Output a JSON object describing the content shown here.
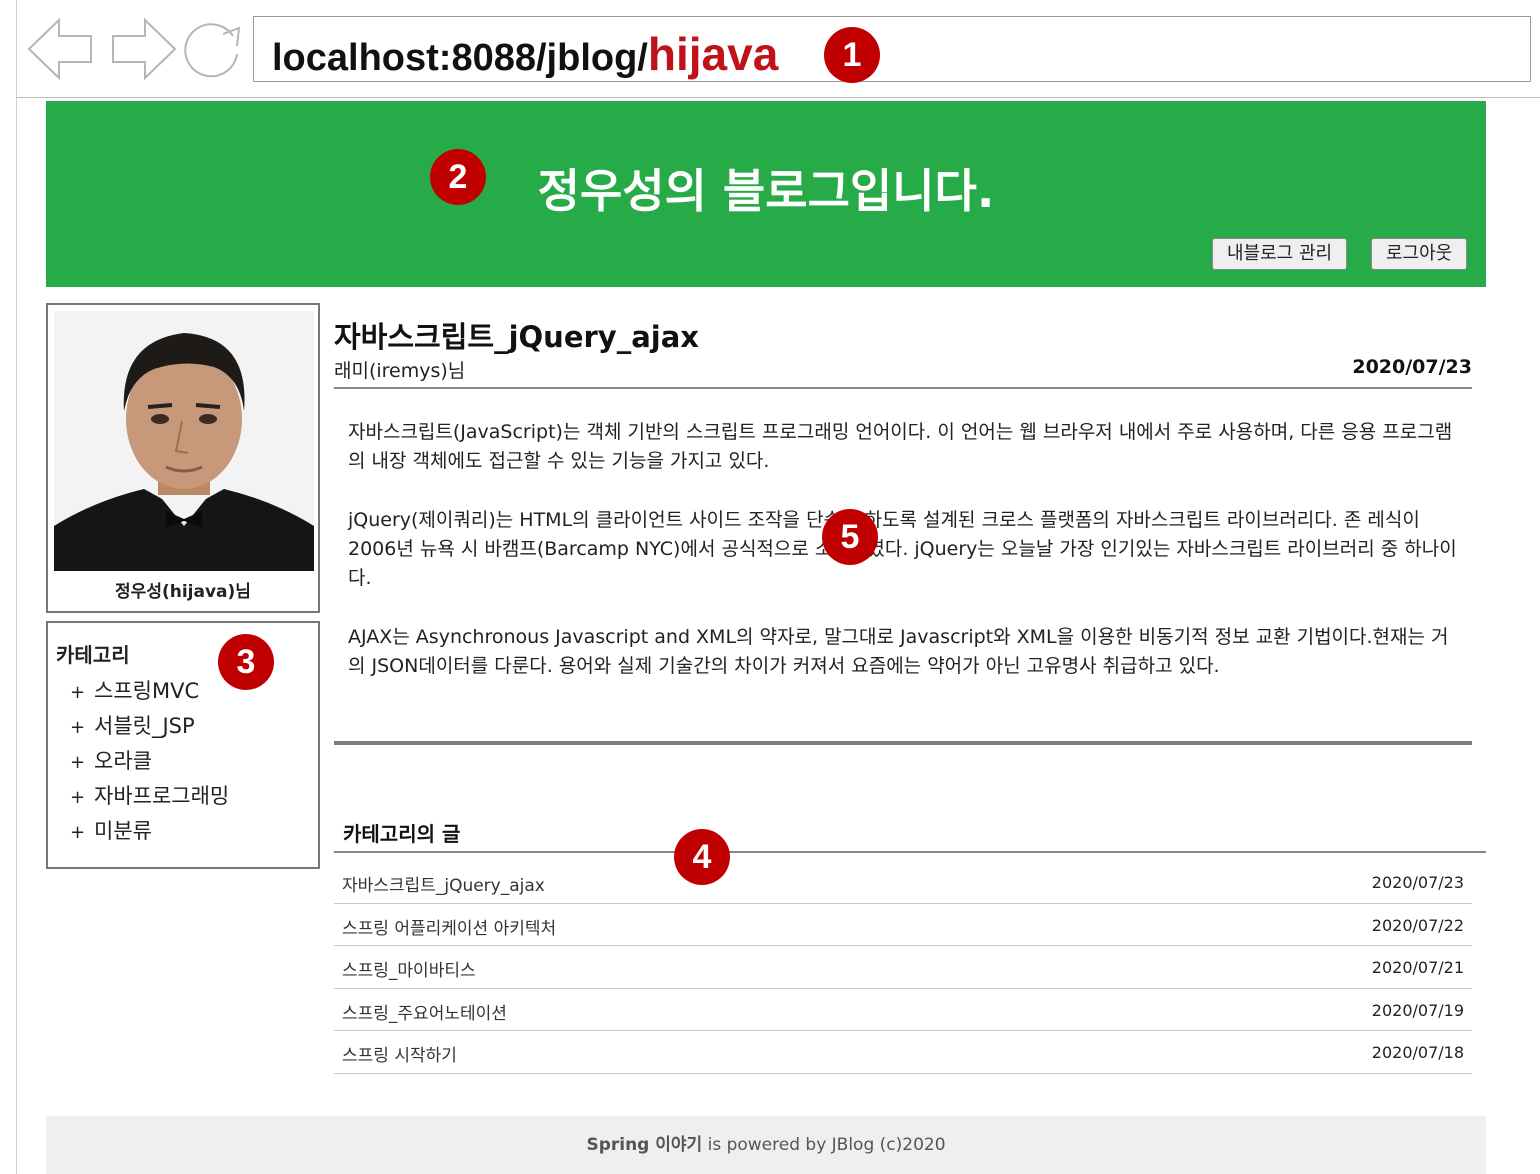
{
  "browser": {
    "url_prefix": "localhost:8088/jblog/",
    "url_highlight": "hijava"
  },
  "markers": [
    "1",
    "2",
    "3",
    "4",
    "5"
  ],
  "header": {
    "blog_title": "정우성의 블로그입니다.",
    "manage_button": "내블로그 관리",
    "logout_button": "로그아웃",
    "background_color": "#27ab48"
  },
  "profile": {
    "name": "정우성(hijava)님"
  },
  "categories": {
    "title": "카테고리",
    "items": [
      {
        "label": "스프링MVC"
      },
      {
        "label": "서블릿_JSP"
      },
      {
        "label": "오라클"
      },
      {
        "label": "자바프로그래밍"
      },
      {
        "label": "미분류"
      }
    ]
  },
  "post": {
    "title": "자바스크립트_jQuery_ajax",
    "author": "래미(iremys)님",
    "date": "2020/07/23",
    "paragraphs": [
      "자바스크립트(JavaScript)는 객체 기반의 스크립트 프로그래밍 언어이다. 이 언어는 웹 브라우저 내에서 주로 사용하며, 다른 응용 프로그램의 내장 객체에도 접근할 수 있는 기능을 가지고 있다.",
      "jQuery(제이쿼리)는 HTML의 클라이언트 사이드 조작을 단순화 하도록 설계된 크로스 플랫폼의 자바스크립트 라이브러리다. 존 레식이 2006년 뉴욕 시 바캠프(Barcamp NYC)에서 공식적으로 소개하였다. jQuery는 오늘날 가장 인기있는 자바스크립트 라이브러리 중 하나이다.",
      "AJAX는 Asynchronous Javascript and XML의 약자로, 말그대로 Javascript와 XML을 이용한 비동기적 정보 교환 기법이다.현재는 거의 JSON데이터를 다룬다. 용어와 실제 기술간의 차이가 커져서 요즘에는 약어가 아닌 고유명사 취급하고 있다."
    ]
  },
  "category_posts": {
    "title": "카테고리의 글",
    "rows": [
      {
        "title": "자바스크립트_jQuery_ajax",
        "date": "2020/07/23"
      },
      {
        "title": "스프링 어플리케이션 아키텍처",
        "date": "2020/07/22"
      },
      {
        "title": "스프링_마이바티스",
        "date": "2020/07/21"
      },
      {
        "title": "스프링_주요어노테이션",
        "date": "2020/07/19"
      },
      {
        "title": "스프링 시작하기",
        "date": "2020/07/18"
      }
    ]
  },
  "footer": {
    "brand": "Spring 이야기",
    "text": " is powered by JBlog (c)2020"
  }
}
